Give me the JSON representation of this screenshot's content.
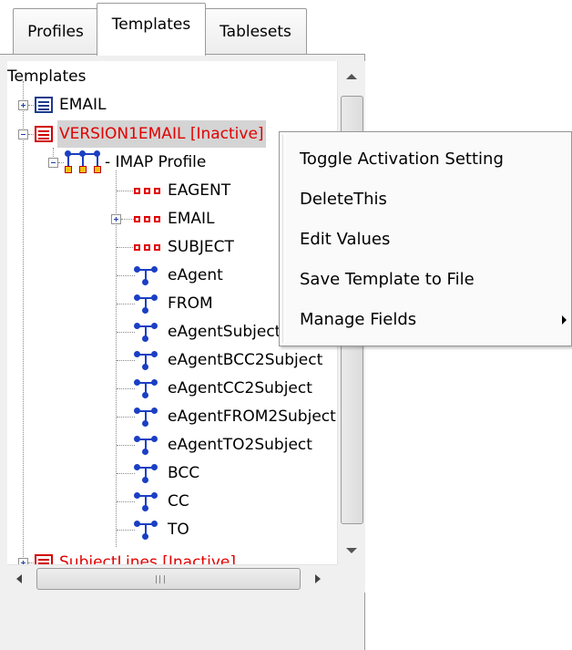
{
  "tabs": [
    {
      "label": "Profiles"
    },
    {
      "label": "Templates",
      "active": true
    },
    {
      "label": "Tablesets"
    }
  ],
  "tree": {
    "root_label": "Templates",
    "nodes": [
      {
        "label": "EMAIL",
        "icon": "template-doc-icon",
        "color": "#000000"
      },
      {
        "label": "VERSION1EMAIL [Inactive]",
        "icon": "template-doc-icon",
        "color": "#e00000",
        "selected": true
      },
      {
        "label": "- IMAP Profile",
        "icon": "profile-group-icon"
      },
      {
        "label": "EAGENT",
        "icon": "field-table-icon"
      },
      {
        "label": "EMAIL",
        "icon": "field-table-icon"
      },
      {
        "label": "SUBJECT",
        "icon": "field-table-icon"
      },
      {
        "label": "eAgent",
        "icon": "field-node-icon"
      },
      {
        "label": "FROM",
        "icon": "field-node-icon"
      },
      {
        "label": "eAgentSubject",
        "icon": "field-node-icon"
      },
      {
        "label": "eAgentBCC2Subject",
        "icon": "field-node-icon"
      },
      {
        "label": "eAgentCC2Subject",
        "icon": "field-node-icon"
      },
      {
        "label": "eAgentFROM2Subject",
        "icon": "field-node-icon"
      },
      {
        "label": "eAgentTO2Subject",
        "icon": "field-node-icon"
      },
      {
        "label": "BCC",
        "icon": "field-node-icon"
      },
      {
        "label": "CC",
        "icon": "field-node-icon"
      },
      {
        "label": "TO",
        "icon": "field-node-icon"
      },
      {
        "label": "SubjectLines [Inactive]",
        "icon": "template-doc-icon",
        "color": "#e00000"
      }
    ]
  },
  "scrollbar": {
    "h_grip": "III"
  },
  "context_menu": {
    "items": [
      {
        "label": "Toggle Activation Setting"
      },
      {
        "label": "DeleteThis"
      },
      {
        "label": "Edit Values"
      },
      {
        "label": "Save Template to File"
      },
      {
        "label": "Manage Fields",
        "has_submenu": true
      }
    ]
  },
  "colors": {
    "inactive": "#e00000",
    "selection": "#d4d4d4",
    "icon_blue": "#1b3fc4"
  }
}
